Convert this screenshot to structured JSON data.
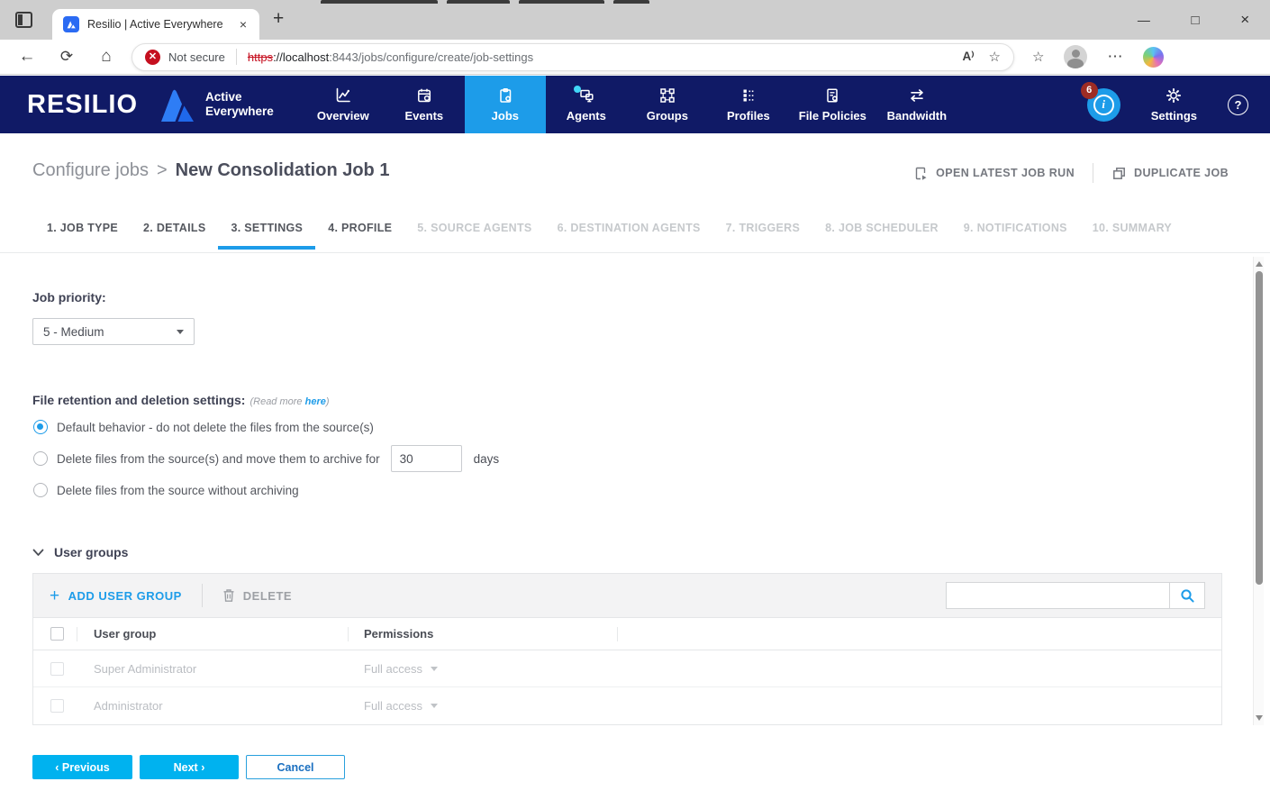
{
  "browser": {
    "tab_title": "Resilio | Active Everywhere",
    "new_tab": "+",
    "close_tab": "×",
    "minimize": "—",
    "maximize": "□",
    "close": "×",
    "back": "←",
    "refresh": "⟳",
    "home": "⌂",
    "security_label": "Not secure",
    "security_glyph": "✕",
    "url_scheme": "https",
    "url_host": "://localhost",
    "url_rest": ":8443/jobs/configure/create/job-settings",
    "readaloud_glyph": "A⁾",
    "star_glyph": "☆",
    "menu_glyph": "⋯"
  },
  "navbar": {
    "brand": "RESILIO",
    "product_line1": "Active",
    "product_line2": "Everywhere",
    "items": [
      {
        "label": "Overview"
      },
      {
        "label": "Events"
      },
      {
        "label": "Jobs"
      },
      {
        "label": "Agents"
      },
      {
        "label": "Groups"
      },
      {
        "label": "Profiles"
      },
      {
        "label": "File Policies"
      },
      {
        "label": "Bandwidth"
      }
    ],
    "notification_count": "6",
    "info_glyph": "i",
    "settings_label": "Settings",
    "help_glyph": "?"
  },
  "header": {
    "breadcrumb_parent": "Configure jobs",
    "breadcrumb_sep": ">",
    "title": "New Consolidation Job 1",
    "action_open_latest": "OPEN LATEST JOB RUN",
    "action_duplicate": "DUPLICATE JOB"
  },
  "steps": [
    "1. JOB TYPE",
    "2. DETAILS",
    "3. SETTINGS",
    "4. PROFILE",
    "5. SOURCE AGENTS",
    "6. DESTINATION AGENTS",
    "7. TRIGGERS",
    "8. JOB SCHEDULER",
    "9. NOTIFICATIONS",
    "10. SUMMARY"
  ],
  "content": {
    "job_priority_label": "Job priority:",
    "job_priority_value": "5 - Medium",
    "retention": {
      "label": "File retention and deletion settings:",
      "read_more_prefix": "(Read more ",
      "read_more_link": "here",
      "read_more_suffix": ")",
      "options": [
        {
          "label": "Default behavior - do not delete the files from the source(s)"
        },
        {
          "label": "Delete files from the source(s) and move them to archive for",
          "value": "30",
          "suffix": "days"
        },
        {
          "label": "Delete files from the source without archiving"
        }
      ]
    },
    "user_groups": {
      "title": "User groups",
      "add_label": "ADD USER GROUP",
      "add_plus": "+",
      "delete_label": "DELETE",
      "columns": {
        "name": "User group",
        "permissions": "Permissions"
      },
      "rows": [
        {
          "name": "Super Administrator",
          "permission": "Full access"
        },
        {
          "name": "Administrator",
          "permission": "Full access"
        }
      ]
    }
  },
  "footer": {
    "previous": "‹ Previous",
    "next": "Next ›",
    "cancel": "Cancel"
  },
  "colors": {
    "navy": "#101a66",
    "accent_blue": "#1d9ce9",
    "button_cyan": "#00b2ef",
    "badge_red": "#9e2c24",
    "not_secure_red": "#c50f1f"
  }
}
